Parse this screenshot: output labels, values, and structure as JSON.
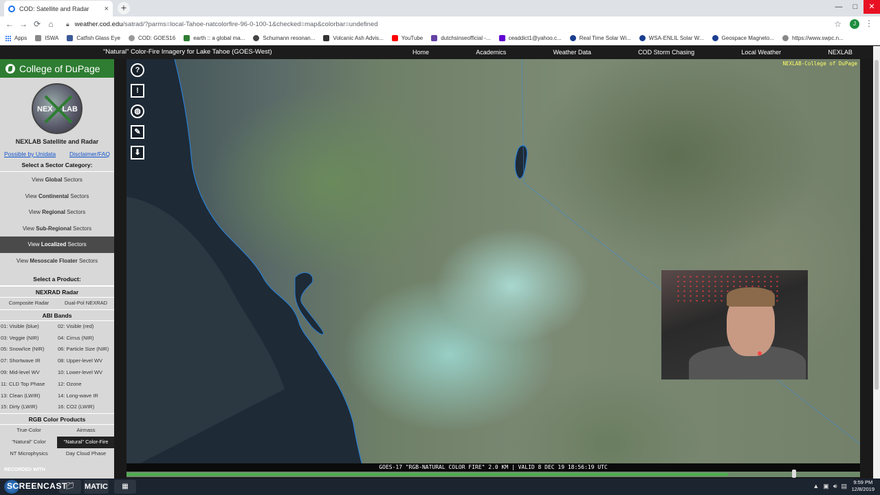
{
  "browser": {
    "tab_title": "COD: Satellite and Radar",
    "tab_close": "×",
    "new_tab": "+",
    "url_host": "weather.cod.edu",
    "url_rest": "/satrad/?parms=local-Tahoe-natcolorfire-96-0-100-1&checked=map&colorbar=undefined",
    "profile_initial": "J",
    "bookmarks": [
      "Apps",
      "ISWA",
      "Catfish Glass Eye",
      "COD: GOES16",
      "earth :: a global ma...",
      "Schumann resonan...",
      "Volcanic Ash Advis...",
      "YouTube",
      "dutchsinseofficial -...",
      "ceaddict1@yahoo.c...",
      "Real Time Solar Wi...",
      "WSA-ENLIL Solar W...",
      "Geospace Magneto...",
      "https://www.swpc.n..."
    ]
  },
  "site": {
    "page_title": "\"Natural\" Color-Fire Imagery for Lake Tahoe (GOES-West)",
    "nav": [
      "Home",
      "Academics",
      "Weather Data",
      "COD Storm Chasing",
      "Local Weather",
      "NEXLAB"
    ]
  },
  "sidebar": {
    "brand": "College of DuPage",
    "logo_left": "NEX",
    "logo_right": "LAB",
    "title": "NEXLAB Satellite and Radar",
    "link_unidata": "Possible by Unidata",
    "link_disclaimer": "Disclaimer/FAQ",
    "sector_heading": "Select a Sector Category:",
    "sectors": [
      {
        "pre": "View ",
        "bold": "Global",
        "post": " Sectors"
      },
      {
        "pre": "View ",
        "bold": "Continental",
        "post": " Sectors"
      },
      {
        "pre": "View ",
        "bold": "Regional",
        "post": " Sectors"
      },
      {
        "pre": "View ",
        "bold": "Sub-Regional",
        "post": " Sectors"
      },
      {
        "pre": "View ",
        "bold": "Localized",
        "post": " Sectors"
      },
      {
        "pre": "View ",
        "bold": "Mesoscale Floater",
        "post": " Sectors"
      }
    ],
    "product_heading": "Select a Product:",
    "nexrad_heading": "NEXRAD Radar",
    "nexrad": [
      "Composite Radar",
      "Dual-Pol NEXRAD"
    ],
    "abi_heading": "ABI Bands",
    "abi": [
      "01: Visible (blue)",
      "02: Visible (red)",
      "03: Veggie (NIR)",
      "04: Cirrus (NIR)",
      "05: Snow/Ice (NIR)",
      "06: Particle Size (NIR)",
      "07: Shortwave IR",
      "08: Upper-level WV",
      "09: Mid-level WV",
      "10: Lower-level WV",
      "11: CLD Top Phase",
      "12: Ozone",
      "13: Clean (LWIR)",
      "14: Long-wave IR",
      "15: Dirty (LWIR)",
      "16: CO2 (LWIR)"
    ],
    "rgb_heading": "RGB Color Products",
    "rgb": [
      "True-Color",
      "Airmass",
      "\"Natural\" Color",
      "\"Natural\" Color-Fire",
      "NT Microphysics",
      "Day Cloud Phase"
    ]
  },
  "map": {
    "credit": "NEXLAB-College of DuPage",
    "timestamp": "GOES-17 \"RGB-NATURAL COLOR FIRE\" 2.0 KM | VALID 8 DEC 19 18:56:19 UTC",
    "tools": [
      "?",
      "!",
      "globe-icon",
      "draw-icon",
      "download-icon"
    ]
  },
  "overlay": {
    "recorded_with": "RECORDED WITH",
    "screencast": "SCREENCAST",
    "matic": "MATIC"
  },
  "taskbar": {
    "time": "9:59 PM",
    "date": "12/8/2019"
  }
}
